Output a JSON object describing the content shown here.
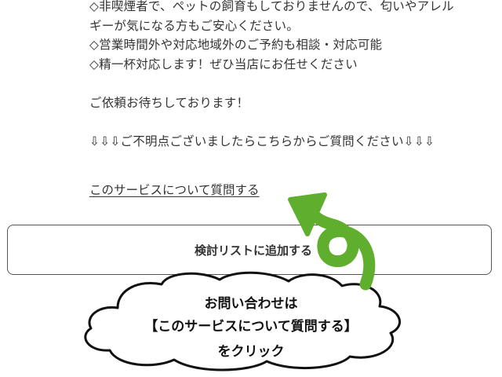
{
  "description": {
    "lines": [
      "◇非喫煙者で、ペットの飼育もしておりませんので、匂いやアレル",
      "ギーが気になる方もご安心ください。",
      "◇営業時間外や対応地域外のご予約も相談・対応可能",
      "◇精一杯対応します！ぜひ当店にお任せください",
      "",
      "ご依頼お待ちしております！",
      "",
      "⇩⇩⇩ご不明点ございましたらこちらからご質問ください⇩⇩⇩"
    ]
  },
  "inquiry_link": {
    "label": "このサービスについて質問する"
  },
  "add_to_list_button": {
    "label": "検討リストに追加する"
  },
  "callout": {
    "line1": "お問い合わせは",
    "line2": "【このサービスについて質問する】",
    "line3": "をクリック",
    "bubble_color": "#ffffff",
    "outline_color": "#111111"
  },
  "arrow": {
    "icon": "curly-arrow-icon",
    "color": "#5fae2e"
  }
}
